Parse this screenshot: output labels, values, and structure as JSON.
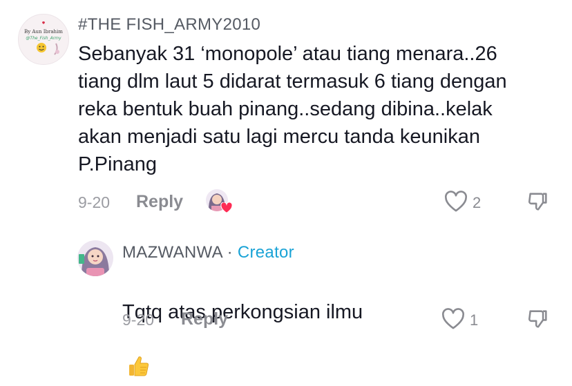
{
  "comment": {
    "username": "#THE FISH_ARMY2010",
    "avatar_caption": "By Aun Ibrahim",
    "avatar_handle": "@The_Fish_Army",
    "text": "Sebanyak 31 ‘monopole’ atau tiang menara..26\ntiang dlm laut 5 didarat termasuk 6 tiang dengan\nreka bentuk buah pinang..sedang dibina..kelak\nakan menjadi satu lagi mercu tanda keunikan\nP.Pinang",
    "date": "9-20",
    "reply_label": "Reply",
    "like_count": "2",
    "creator_liked": true
  },
  "reply": {
    "username": "MAZWANWA",
    "separator": " · ",
    "badge": "Creator",
    "text": "Tqtq atas perkongsian ilmu",
    "emoji": "👍",
    "date": "9-20",
    "reply_label": "Reply",
    "like_count": "1"
  },
  "icons": {
    "like": "heart-outline-icon",
    "dislike": "thumbs-down-icon",
    "creator_like_badge": "heart-filled-icon"
  },
  "colors": {
    "text": "#161823",
    "muted": "#8a8b91",
    "creator": "#1aa3d6",
    "heart": "#fe2c55"
  }
}
